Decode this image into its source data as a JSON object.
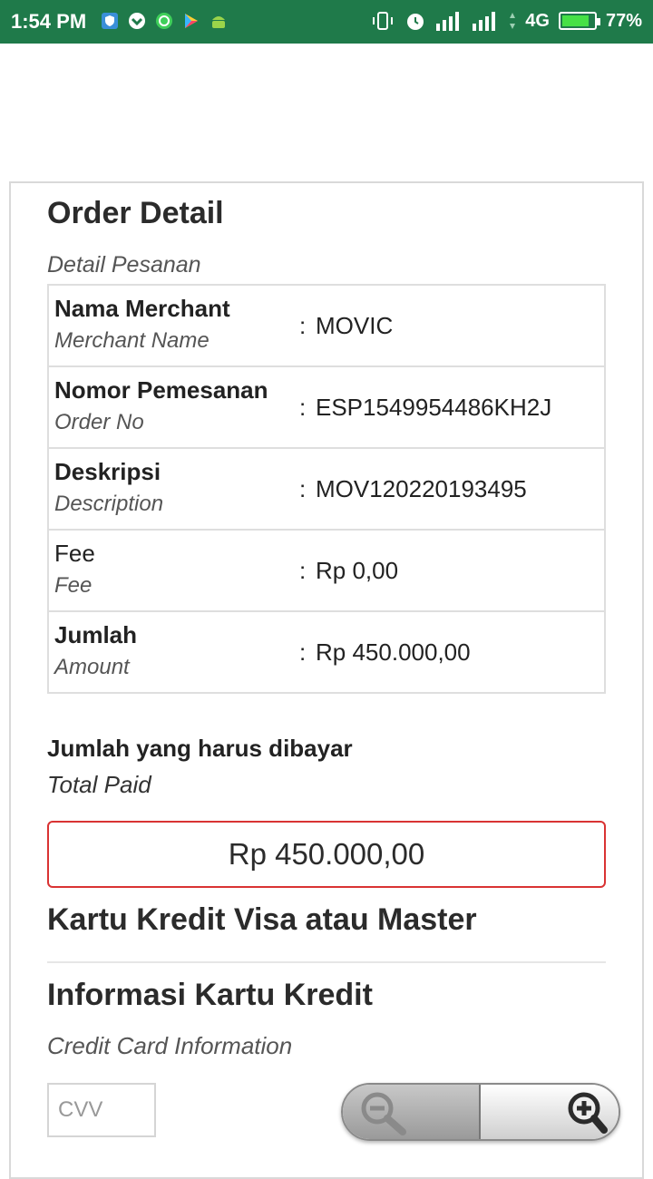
{
  "status_bar": {
    "time": "1:54 PM",
    "network": "4G",
    "battery": "77%",
    "battery_level": 0.77,
    "left_icons": [
      "shield-icon",
      "pin-icon",
      "whatsapp-icon",
      "play-store-icon",
      "android-icon"
    ],
    "right_icons": [
      "vibrate-icon",
      "alarm-icon",
      "signal-icon",
      "signal-icon",
      "data-arrows-icon",
      "battery-icon"
    ]
  },
  "order": {
    "title": "Order Detail",
    "subtitle": "Detail Pesanan",
    "rows": [
      {
        "label": "Nama Merchant",
        "sublabel": "Merchant Name",
        "colon": ":",
        "value": "MOVIC"
      },
      {
        "label": "Nomor Pemesanan",
        "sublabel": "Order No",
        "colon": ":",
        "value": "ESP1549954486KH2J"
      },
      {
        "label": "Deskripsi",
        "sublabel": "Description",
        "colon": ":",
        "value": "MOV120220193495"
      },
      {
        "label": "Fee",
        "sublabel": "Fee",
        "colon": ":",
        "value": "Rp 0,00"
      },
      {
        "label": "Jumlah",
        "sublabel": "Amount",
        "colon": ":",
        "value": "Rp 450.000,00"
      }
    ]
  },
  "total": {
    "label": "Jumlah yang harus dibayar",
    "sublabel": "Total Paid",
    "amount": "Rp 450.000,00"
  },
  "payment": {
    "card_type": "Kartu Kredit Visa atau Master",
    "info_title": "Informasi Kartu Kredit",
    "info_subtitle": "Credit Card Information",
    "cvv_placeholder": "CVV"
  },
  "colors": {
    "status_bar": "#1f7a4a",
    "total_border": "#d93333"
  }
}
